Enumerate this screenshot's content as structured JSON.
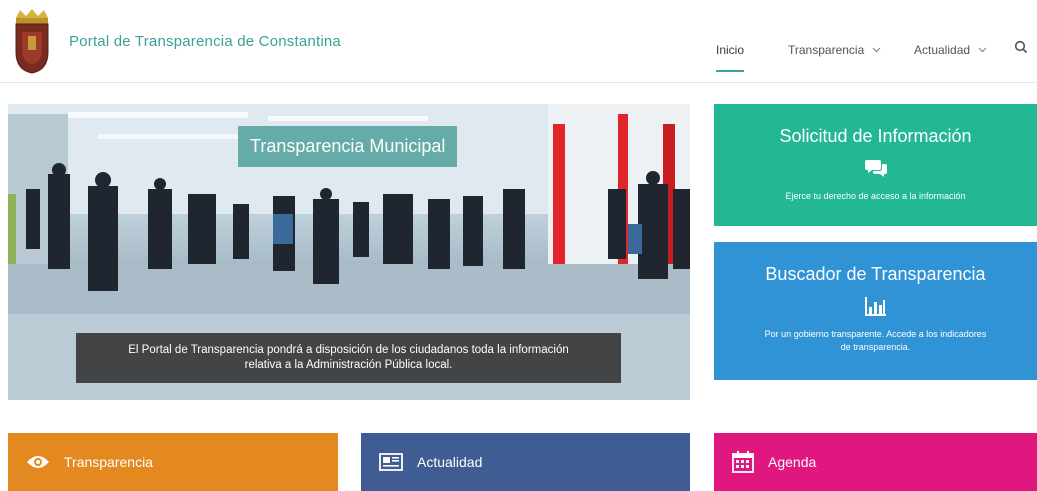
{
  "header": {
    "site_title": "Portal de  Transparencia de Constantina"
  },
  "nav": {
    "items": [
      {
        "label": "Inicio"
      },
      {
        "label": "Transparencia"
      },
      {
        "label": "Actualidad"
      }
    ]
  },
  "hero": {
    "slide_title": "Transparencia Municipal",
    "caption_line1": "El Portal de Transparencia pondrá a disposición de los ciudadanos toda la información",
    "caption_line2": "relativa a la Administración Pública local."
  },
  "tiles": {
    "solicitud": {
      "title": "Solicitud de Información",
      "text": "Ejerce tu derecho de acceso a la información"
    },
    "buscador": {
      "title": "Buscador de Transparencia",
      "text_line1": "Por un gobierno transparente. Accede a los indicadores",
      "text_line2": "de transparencia."
    }
  },
  "bottom": {
    "transparencia": "Transparencia",
    "actualidad": "Actualidad",
    "agenda": "Agenda"
  },
  "colors": {
    "accent_teal": "#3aa29a",
    "tile_green": "#22b795",
    "tile_blue": "#2f93d6",
    "orange": "#e38920",
    "navy": "#3f5c93",
    "pink": "#df177f"
  },
  "icons": [
    "coat-of-arms-logo",
    "chevron-down-icon",
    "search-icon",
    "comments-icon",
    "bar-chart-icon",
    "eye-icon",
    "newspaper-icon",
    "calendar-icon"
  ]
}
